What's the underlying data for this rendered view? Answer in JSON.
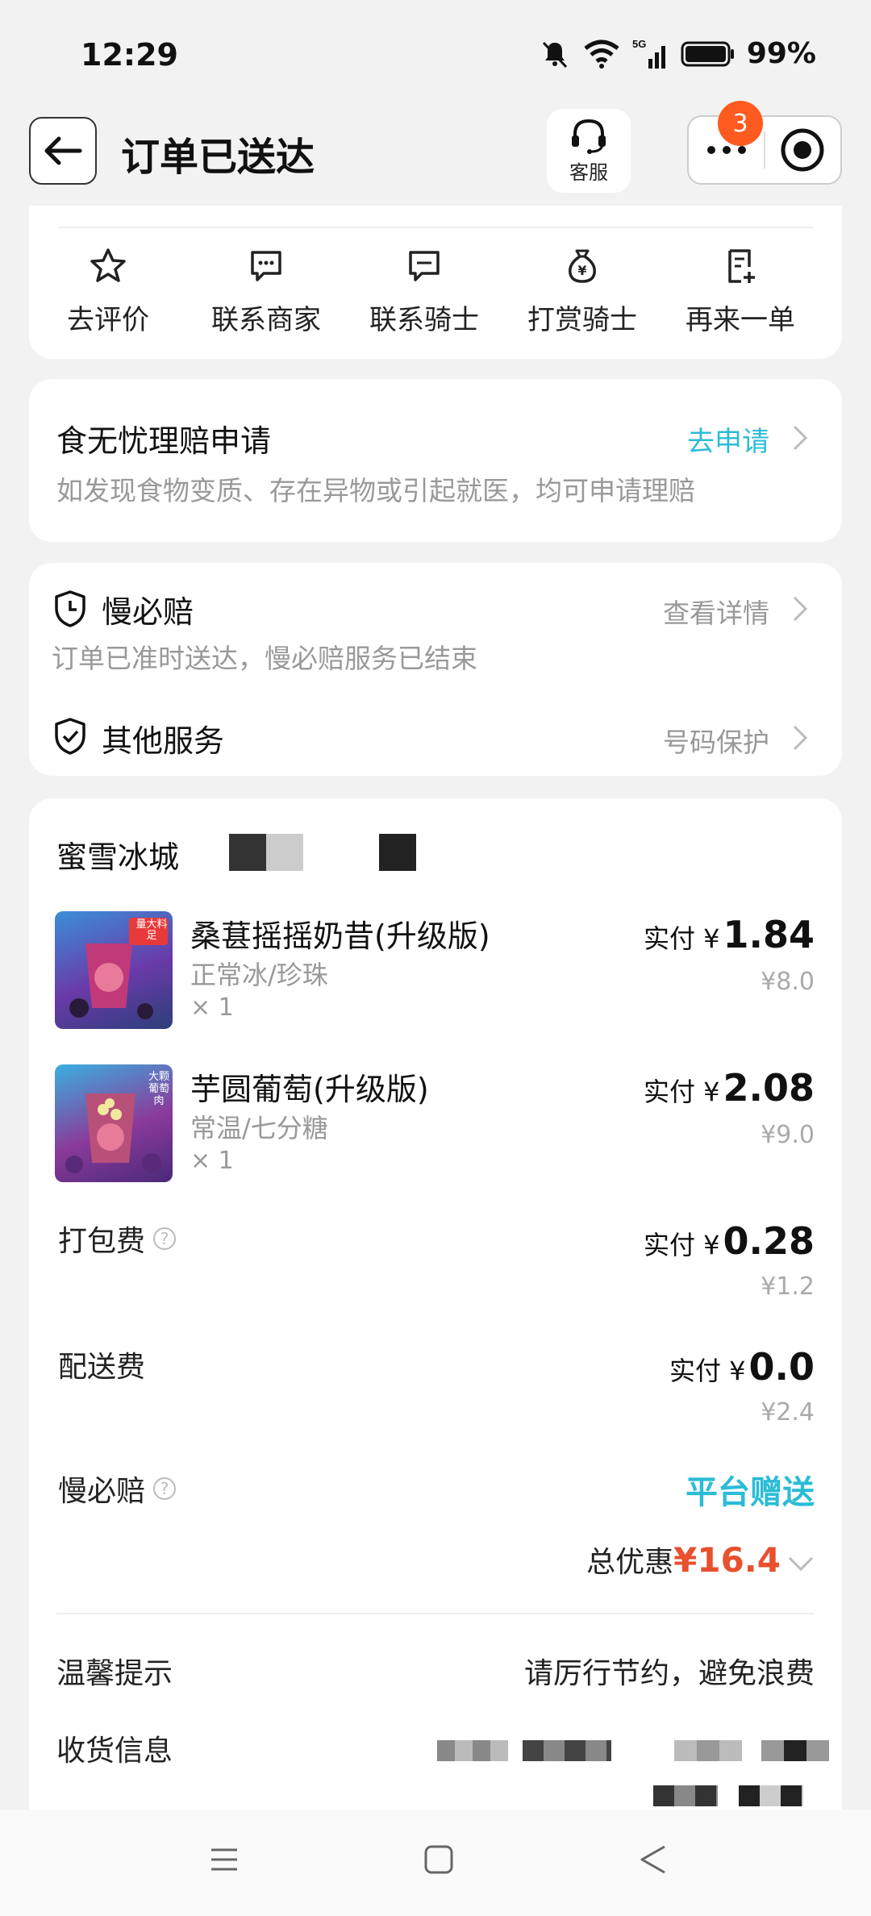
{
  "status_bar": {
    "time": "12:29",
    "network": "5G",
    "battery": "99%"
  },
  "header": {
    "title": "订单已送达",
    "customer_service": "客服",
    "badge_count": "3"
  },
  "actions": [
    {
      "label": "去评价",
      "icon": "star-icon"
    },
    {
      "label": "联系商家",
      "icon": "chat-icon"
    },
    {
      "label": "联系骑士",
      "icon": "chat-icon"
    },
    {
      "label": "打赏骑士",
      "icon": "money-bag-icon"
    },
    {
      "label": "再来一单",
      "icon": "reorder-icon"
    }
  ],
  "claim": {
    "title": "食无忧理赔申请",
    "link": "去申请",
    "desc": "如发现食物变质、存在异物或引起就医，均可申请理赔"
  },
  "services": {
    "slow_title": "慢必赔",
    "slow_link": "查看详情",
    "slow_desc": "订单已准时送达，慢必赔服务已结束",
    "other_title": "其他服务",
    "other_link": "号码保护"
  },
  "order": {
    "shop": "蜜雪冰城",
    "items": [
      {
        "name": "桑葚摇摇奶昔(升级版)",
        "spec": "正常冰/珍珠",
        "qty": "× 1",
        "pay_prefix": "实付 ¥",
        "pay": "1.84",
        "orig": "¥8.0",
        "img_tag": "量大料足"
      },
      {
        "name": "芋圆葡萄(升级版)",
        "spec": "常温/七分糖",
        "qty": "× 1",
        "pay_prefix": "实付 ¥",
        "pay": "2.08",
        "orig": "¥9.0",
        "img_tag": "大颗葡萄肉"
      }
    ],
    "packing": {
      "label": "打包费",
      "pay_prefix": "实付 ¥",
      "pay": "0.28",
      "orig": "¥1.2"
    },
    "delivery": {
      "label": "配送费",
      "pay_prefix": "实付 ¥",
      "pay": "0.0",
      "orig": "¥2.4"
    },
    "slow_comp": {
      "label": "慢必赔",
      "value": "平台赠送"
    },
    "total_discount": {
      "label": "总优惠",
      "value": "¥16.4"
    },
    "tip": {
      "label": "温馨提示",
      "value": "请厉行节约，避免浪费"
    },
    "receiver_label": "收货信息"
  },
  "colors": {
    "accent": "#2bbcd6",
    "price_red": "#e8502e",
    "badge": "#ff5a1f"
  }
}
